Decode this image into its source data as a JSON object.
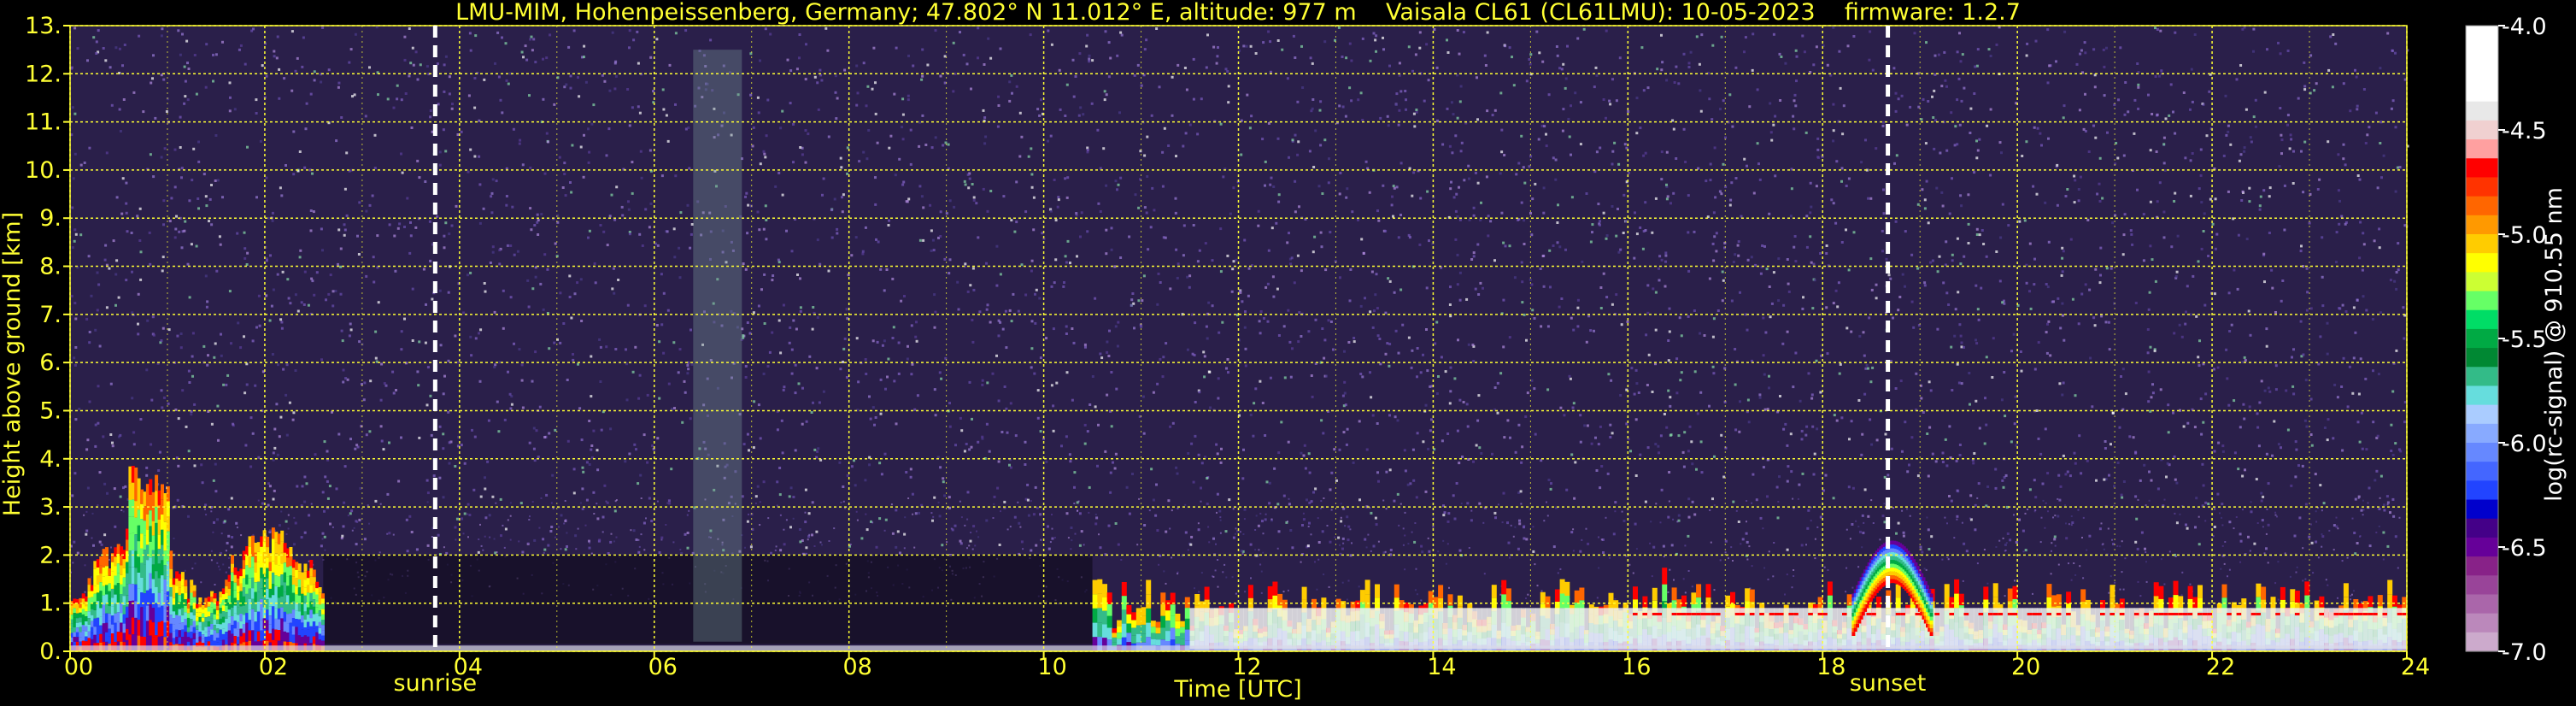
{
  "chart_data": {
    "type": "heatmap",
    "title": "LMU-MIM, Hohenpeissenberg, Germany; 47.802° N 11.012° E, altitude: 977 m    Vaisala CL61 (CL61LMU): 10-05-2023    firmware: 1.2.7",
    "xlabel": "Time [UTC]",
    "ylabel": "Height above ground [km]",
    "xlim": [
      0,
      24
    ],
    "ylim": [
      0,
      13
    ],
    "x_ticks": [
      0,
      2,
      4,
      6,
      8,
      10,
      12,
      14,
      16,
      18,
      20,
      22,
      24
    ],
    "x_tick_labels": [
      "00",
      "02",
      "04",
      "06",
      "08",
      "10",
      "12",
      "14",
      "16",
      "18",
      "20",
      "22",
      "24"
    ],
    "y_ticks": [
      0,
      1,
      2,
      3,
      4,
      5,
      6,
      7,
      8,
      9,
      10,
      11,
      12,
      13
    ],
    "y_tick_labels": [
      "0.",
      "1.",
      "2.",
      "3.",
      "4.",
      "5.",
      "6.",
      "7.",
      "8.",
      "9.",
      "10.",
      "11.",
      "12.",
      "13."
    ],
    "grid": true,
    "annotations": [
      {
        "label": "sunrise",
        "x": 3.75
      },
      {
        "label": "sunset",
        "x": 18.67
      }
    ],
    "colorbar": {
      "label": "log(rc-signal) @ 910.55 nm",
      "range": [
        -7.0,
        -4.0
      ],
      "ticks": [
        -4.0,
        -4.5,
        -5.0,
        -5.5,
        -6.0,
        -6.5,
        -7.0
      ],
      "tick_labels": [
        "-4.0",
        "-4.5",
        "-5.0",
        "-5.5",
        "-6.0",
        "-6.5",
        "-7.0"
      ],
      "colors_top_to_bottom": [
        "#ffffff",
        "#ffffff",
        "#ffffff",
        "#ffffff",
        "#e8e8e8",
        "#f0d0d0",
        "#ffa0a0",
        "#ff0000",
        "#ff3300",
        "#ff6600",
        "#ff9900",
        "#ffcc00",
        "#ffff00",
        "#ccff33",
        "#66ff66",
        "#00dd66",
        "#00aa44",
        "#008833",
        "#33bb88",
        "#66dddd",
        "#aaccff",
        "#88aaff",
        "#6688ff",
        "#4466ff",
        "#2244ff",
        "#0000cc",
        "#440088",
        "#660099",
        "#882288",
        "#994499",
        "#aa66aa",
        "#bb88bb",
        "#ccaacc"
      ]
    },
    "colors": {
      "text": "#ffff33",
      "grid": "#ffff33",
      "background": "#000000",
      "noise": "#8866cc"
    },
    "features": [
      {
        "name": "boundary-layer-aerosol-morning",
        "x_range": [
          0,
          2.6
        ],
        "top_km": 3.5
      },
      {
        "name": "precipitation-column",
        "x_range": [
          6.4,
          6.9
        ],
        "top_km": 12.5
      },
      {
        "name": "low-clouds-afternoon",
        "x_range": [
          10.5,
          24
        ],
        "top_km": 1.8
      },
      {
        "name": "cloud-top-evening",
        "x_range": [
          18.3,
          19.1
        ],
        "top_km": 2.3
      }
    ]
  }
}
